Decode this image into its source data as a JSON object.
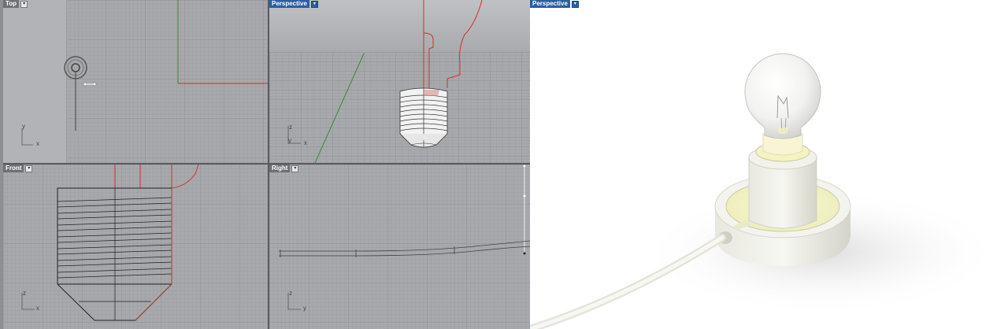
{
  "viewports": {
    "top": {
      "title": "Top",
      "axis_y": "y",
      "axis_x": "x"
    },
    "perspective": {
      "title": "Perspective",
      "axis_z": "z",
      "axis_y": "y",
      "axis_x": "x"
    },
    "front": {
      "title": "Front",
      "axis_z": "z",
      "axis_x": "x"
    },
    "right": {
      "title": "Right",
      "axis_z": "z",
      "axis_y": "y"
    },
    "render": {
      "title": "Perspective"
    }
  },
  "dropdown_glyph": "▾",
  "colors": {
    "active_tab": "#2c5ea1",
    "curve_red": "#d0312d",
    "axis_green": "#3c8a3c"
  }
}
